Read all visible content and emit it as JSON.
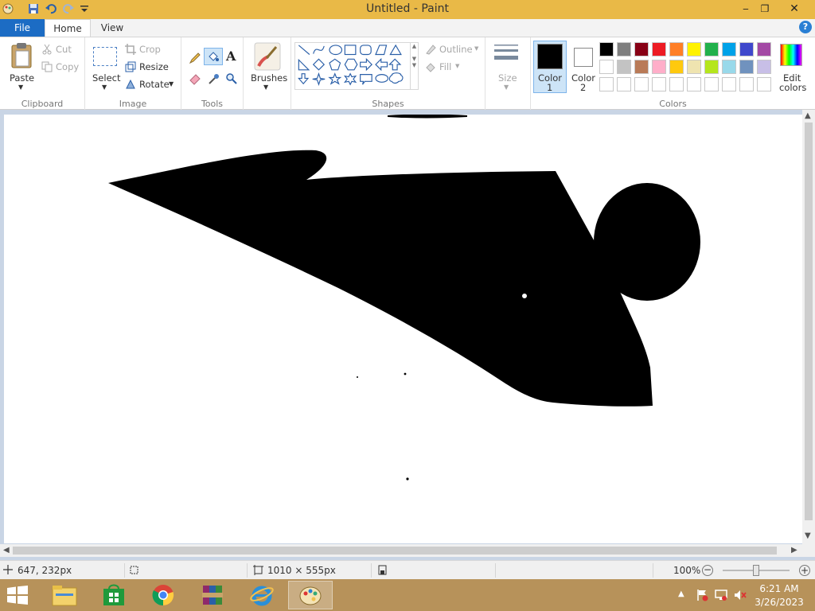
{
  "window": {
    "title": "Untitled - Paint",
    "minimize": "‒",
    "restore": "❐",
    "close": "✕"
  },
  "tabs": {
    "file": "File",
    "home": "Home",
    "view": "View"
  },
  "help": "?",
  "clipboard": {
    "paste": "Paste",
    "cut": "Cut",
    "copy": "Copy",
    "label": "Clipboard"
  },
  "image": {
    "select": "Select",
    "crop": "Crop",
    "resize": "Resize",
    "rotate": "Rotate",
    "label": "Image"
  },
  "tools": {
    "label": "Tools"
  },
  "brushes": {
    "label": "Brushes"
  },
  "shapes": {
    "outline": "Outline",
    "fill": "Fill",
    "label": "Shapes"
  },
  "size": {
    "label": "Size"
  },
  "colors": {
    "color1_a": "Color",
    "color1_b": "1",
    "color2_a": "Color",
    "color2_b": "2",
    "edit_a": "Edit",
    "edit_b": "colors",
    "label": "Colors",
    "color1_value": "#000000",
    "color2_value": "#ffffff",
    "palette_row1": [
      "#000000",
      "#7f7f7f",
      "#880015",
      "#ed1c24",
      "#ff7f27",
      "#fff200",
      "#22b14c",
      "#00a2e8",
      "#3f48cc",
      "#a349a4"
    ],
    "palette_row2": [
      "#ffffff",
      "#c3c3c3",
      "#b97a57",
      "#ffaec9",
      "#ffc90e",
      "#efe4b0",
      "#b5e61d",
      "#99d9ea",
      "#7092be",
      "#c8bfe7"
    ],
    "palette_row3": [
      "#ffffff",
      "#ffffff",
      "#ffffff",
      "#ffffff",
      "#ffffff",
      "#ffffff",
      "#ffffff",
      "#ffffff",
      "#ffffff",
      "#ffffff"
    ]
  },
  "status": {
    "cursor_pos": "647, 232px",
    "canvas_size": "1010 × 555px",
    "zoom": "100%"
  },
  "taskbar": {
    "time": "6:21 AM",
    "date": "3/26/2023"
  }
}
